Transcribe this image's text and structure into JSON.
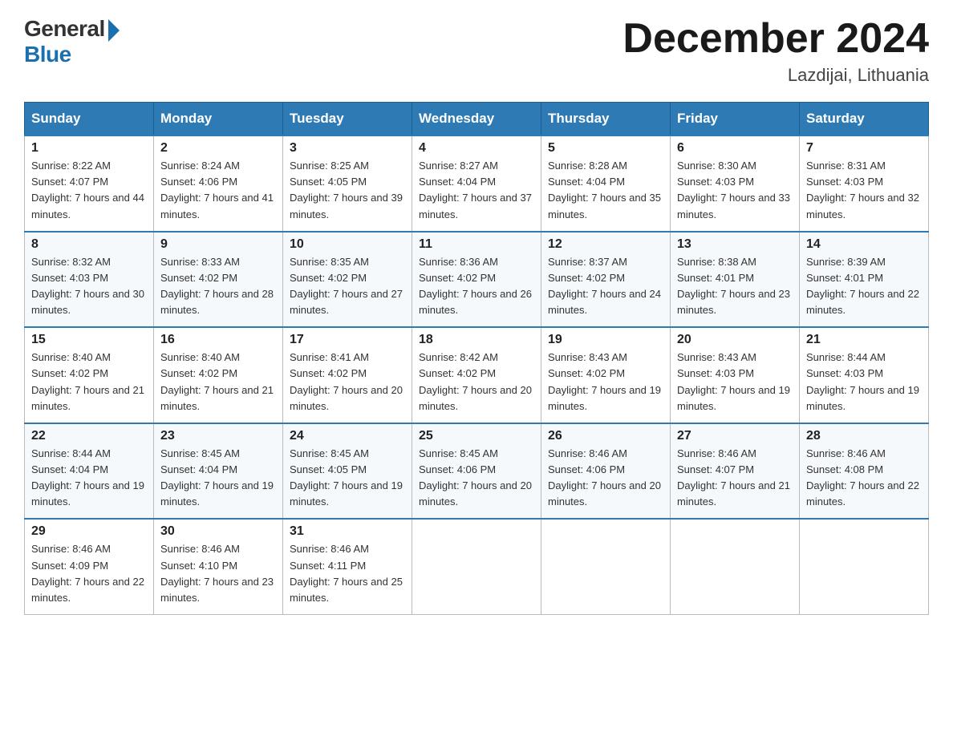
{
  "header": {
    "logo_general": "General",
    "logo_blue": "Blue",
    "month_title": "December 2024",
    "location": "Lazdijai, Lithuania"
  },
  "weekdays": [
    "Sunday",
    "Monday",
    "Tuesday",
    "Wednesday",
    "Thursday",
    "Friday",
    "Saturday"
  ],
  "weeks": [
    [
      {
        "day": "1",
        "sunrise": "8:22 AM",
        "sunset": "4:07 PM",
        "daylight": "7 hours and 44 minutes."
      },
      {
        "day": "2",
        "sunrise": "8:24 AM",
        "sunset": "4:06 PM",
        "daylight": "7 hours and 41 minutes."
      },
      {
        "day": "3",
        "sunrise": "8:25 AM",
        "sunset": "4:05 PM",
        "daylight": "7 hours and 39 minutes."
      },
      {
        "day": "4",
        "sunrise": "8:27 AM",
        "sunset": "4:04 PM",
        "daylight": "7 hours and 37 minutes."
      },
      {
        "day": "5",
        "sunrise": "8:28 AM",
        "sunset": "4:04 PM",
        "daylight": "7 hours and 35 minutes."
      },
      {
        "day": "6",
        "sunrise": "8:30 AM",
        "sunset": "4:03 PM",
        "daylight": "7 hours and 33 minutes."
      },
      {
        "day": "7",
        "sunrise": "8:31 AM",
        "sunset": "4:03 PM",
        "daylight": "7 hours and 32 minutes."
      }
    ],
    [
      {
        "day": "8",
        "sunrise": "8:32 AM",
        "sunset": "4:03 PM",
        "daylight": "7 hours and 30 minutes."
      },
      {
        "day": "9",
        "sunrise": "8:33 AM",
        "sunset": "4:02 PM",
        "daylight": "7 hours and 28 minutes."
      },
      {
        "day": "10",
        "sunrise": "8:35 AM",
        "sunset": "4:02 PM",
        "daylight": "7 hours and 27 minutes."
      },
      {
        "day": "11",
        "sunrise": "8:36 AM",
        "sunset": "4:02 PM",
        "daylight": "7 hours and 26 minutes."
      },
      {
        "day": "12",
        "sunrise": "8:37 AM",
        "sunset": "4:02 PM",
        "daylight": "7 hours and 24 minutes."
      },
      {
        "day": "13",
        "sunrise": "8:38 AM",
        "sunset": "4:01 PM",
        "daylight": "7 hours and 23 minutes."
      },
      {
        "day": "14",
        "sunrise": "8:39 AM",
        "sunset": "4:01 PM",
        "daylight": "7 hours and 22 minutes."
      }
    ],
    [
      {
        "day": "15",
        "sunrise": "8:40 AM",
        "sunset": "4:02 PM",
        "daylight": "7 hours and 21 minutes."
      },
      {
        "day": "16",
        "sunrise": "8:40 AM",
        "sunset": "4:02 PM",
        "daylight": "7 hours and 21 minutes."
      },
      {
        "day": "17",
        "sunrise": "8:41 AM",
        "sunset": "4:02 PM",
        "daylight": "7 hours and 20 minutes."
      },
      {
        "day": "18",
        "sunrise": "8:42 AM",
        "sunset": "4:02 PM",
        "daylight": "7 hours and 20 minutes."
      },
      {
        "day": "19",
        "sunrise": "8:43 AM",
        "sunset": "4:02 PM",
        "daylight": "7 hours and 19 minutes."
      },
      {
        "day": "20",
        "sunrise": "8:43 AM",
        "sunset": "4:03 PM",
        "daylight": "7 hours and 19 minutes."
      },
      {
        "day": "21",
        "sunrise": "8:44 AM",
        "sunset": "4:03 PM",
        "daylight": "7 hours and 19 minutes."
      }
    ],
    [
      {
        "day": "22",
        "sunrise": "8:44 AM",
        "sunset": "4:04 PM",
        "daylight": "7 hours and 19 minutes."
      },
      {
        "day": "23",
        "sunrise": "8:45 AM",
        "sunset": "4:04 PM",
        "daylight": "7 hours and 19 minutes."
      },
      {
        "day": "24",
        "sunrise": "8:45 AM",
        "sunset": "4:05 PM",
        "daylight": "7 hours and 19 minutes."
      },
      {
        "day": "25",
        "sunrise": "8:45 AM",
        "sunset": "4:06 PM",
        "daylight": "7 hours and 20 minutes."
      },
      {
        "day": "26",
        "sunrise": "8:46 AM",
        "sunset": "4:06 PM",
        "daylight": "7 hours and 20 minutes."
      },
      {
        "day": "27",
        "sunrise": "8:46 AM",
        "sunset": "4:07 PM",
        "daylight": "7 hours and 21 minutes."
      },
      {
        "day": "28",
        "sunrise": "8:46 AM",
        "sunset": "4:08 PM",
        "daylight": "7 hours and 22 minutes."
      }
    ],
    [
      {
        "day": "29",
        "sunrise": "8:46 AM",
        "sunset": "4:09 PM",
        "daylight": "7 hours and 22 minutes."
      },
      {
        "day": "30",
        "sunrise": "8:46 AM",
        "sunset": "4:10 PM",
        "daylight": "7 hours and 23 minutes."
      },
      {
        "day": "31",
        "sunrise": "8:46 AM",
        "sunset": "4:11 PM",
        "daylight": "7 hours and 25 minutes."
      },
      null,
      null,
      null,
      null
    ]
  ]
}
